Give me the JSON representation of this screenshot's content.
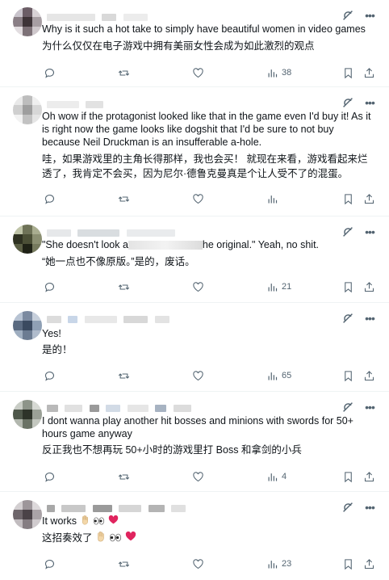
{
  "feed": {
    "tweets": [
      {
        "header_text": "",
        "text_en": "Why is it such a hot take to simply have beautiful women in video games",
        "text_zh": "为什么仅仅在电子游戏中拥有美丽女性会成为如此激烈的观点",
        "views": "38"
      },
      {
        "header_text": "",
        "text_en": "Oh wow if the protagonist looked like that in the game even I'd buy it!  As it is right  now the game looks like dogshit that I'd be sure to not buy because Neil Druckman is an insufferable a-hole.",
        "text_zh": "哇，如果游戏里的主角长得那样，我也会买！ 就现在来看，游戏看起来烂透了，我肯定不会买，因为尼尔·德鲁克曼真是个让人受不了的混蛋。",
        "views": ""
      },
      {
        "header_text": "",
        "text_en": "\"She doesn't look a",
        "text_en_tail": "he original.\" Yeah, no shit.",
        "text_zh": "“她一点也不像原版。”是的，废话。",
        "views": "21"
      },
      {
        "header_text": "",
        "text_en": "Yes!",
        "text_zh": "是的！",
        "views": "65"
      },
      {
        "header_text": "",
        "text_en": "I dont wanna play another hit bosses and minions with swords for 50+ hours game anyway",
        "text_zh": "反正我也不想再玩 50+小时的游戏里打 Boss 和拿剑的小兵",
        "views": "4"
      },
      {
        "header_text": "",
        "text_en": "It works",
        "text_zh": "这招奏效了",
        "views": "23"
      }
    ]
  },
  "colors": {
    "icon_gray": "#536471",
    "heart_red": "#e0245e",
    "divider": "#eff3f4"
  },
  "icons": [
    "reply-icon",
    "retweet-icon",
    "like-icon",
    "views-icon",
    "bookmark-icon",
    "share-icon",
    "grok-icon",
    "more-icon"
  ]
}
